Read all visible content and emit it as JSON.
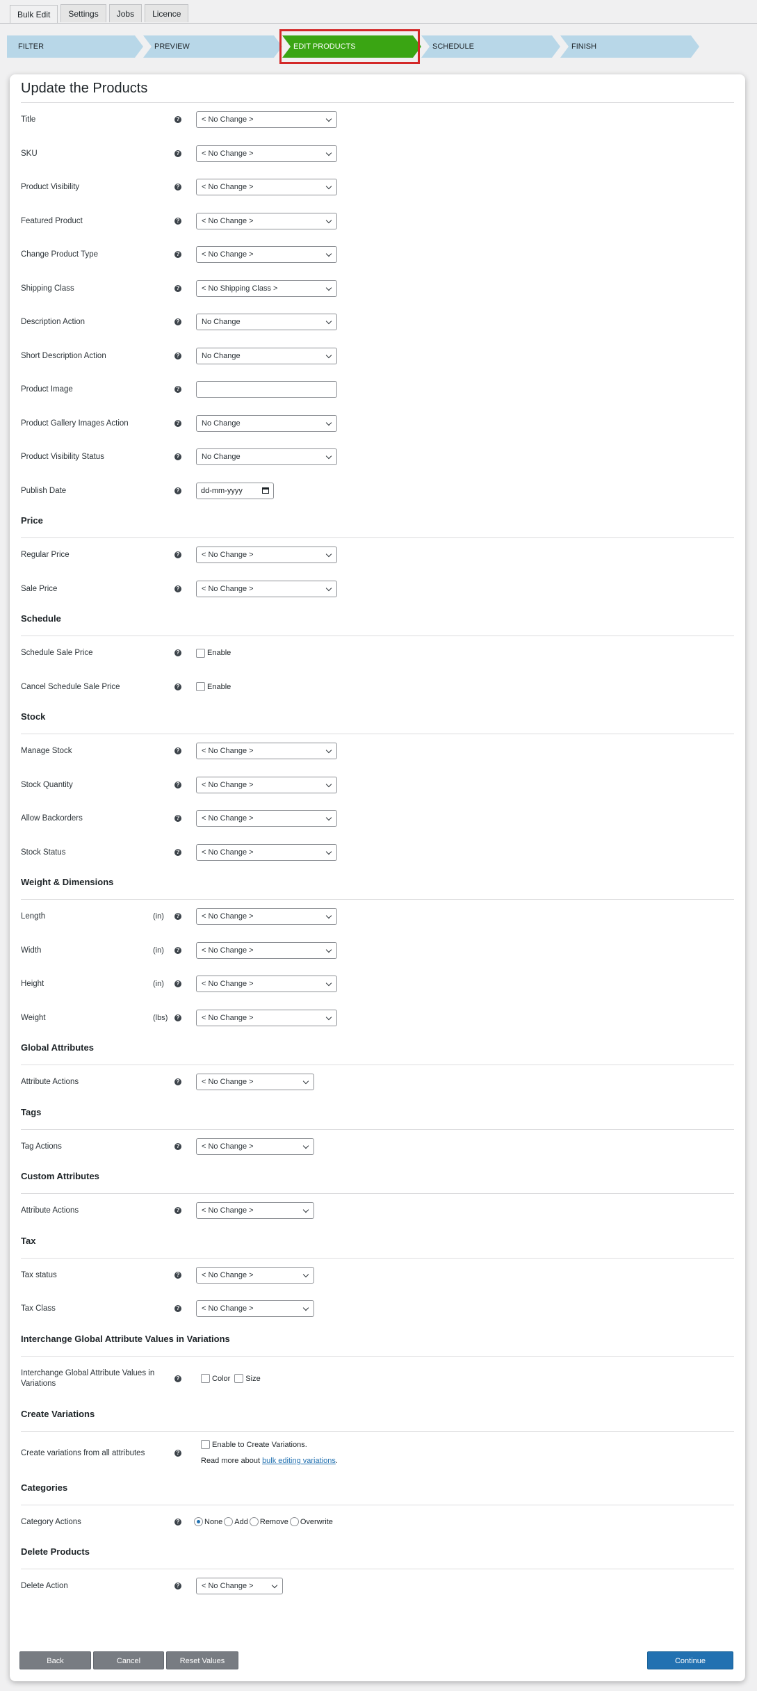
{
  "tabs": [
    "Bulk Edit",
    "Settings",
    "Jobs",
    "Licence"
  ],
  "steps": [
    "FILTER",
    "PREVIEW",
    "EDIT PRODUCTS",
    "SCHEDULE",
    "FINISH"
  ],
  "panel_title": "Update the Products",
  "help_glyph": "?",
  "general": {
    "title": {
      "label": "Title",
      "value": "< No Change >"
    },
    "sku": {
      "label": "SKU",
      "value": "< No Change >"
    },
    "visibility": {
      "label": "Product Visibility",
      "value": "< No Change >"
    },
    "featured": {
      "label": "Featured Product",
      "value": "< No Change >"
    },
    "type": {
      "label": "Change Product Type",
      "value": "< No Change >"
    },
    "shipping": {
      "label": "Shipping Class",
      "value": "< No Shipping Class >"
    },
    "description": {
      "label": "Description Action",
      "value": "No Change"
    },
    "short_description": {
      "label": "Short Description Action",
      "value": "No Change"
    },
    "image": {
      "label": "Product Image",
      "value": ""
    },
    "gallery": {
      "label": "Product Gallery Images Action",
      "value": "No Change"
    },
    "visibility_status": {
      "label": "Product Visibility Status",
      "value": "No Change"
    },
    "publish_date": {
      "label": "Publish Date",
      "placeholder": "dd-mm-yyyy"
    }
  },
  "price": {
    "heading": "Price",
    "regular": {
      "label": "Regular Price",
      "value": "< No Change >"
    },
    "sale": {
      "label": "Sale Price",
      "value": "< No Change >"
    }
  },
  "schedule": {
    "heading": "Schedule",
    "sale": {
      "label": "Schedule Sale Price",
      "option": "Enable"
    },
    "cancel": {
      "label": "Cancel Schedule Sale Price",
      "option": "Enable"
    }
  },
  "stock": {
    "heading": "Stock",
    "manage": {
      "label": "Manage Stock",
      "value": "< No Change >"
    },
    "quantity": {
      "label": "Stock Quantity",
      "value": "< No Change >"
    },
    "backorders": {
      "label": "Allow Backorders",
      "value": "< No Change >"
    },
    "status": {
      "label": "Stock Status",
      "value": "< No Change >"
    }
  },
  "dimensions": {
    "heading": "Weight & Dimensions",
    "length": {
      "label": "Length",
      "unit": "(in)",
      "value": "< No Change >"
    },
    "width": {
      "label": "Width",
      "unit": "(in)",
      "value": "< No Change >"
    },
    "height": {
      "label": "Height",
      "unit": "(in)",
      "value": "< No Change >"
    },
    "weight": {
      "label": "Weight",
      "unit": "(lbs)",
      "value": "< No Change >"
    }
  },
  "global_attributes": {
    "heading": "Global Attributes",
    "action": {
      "label": "Attribute Actions",
      "value": "< No Change >"
    }
  },
  "tags": {
    "heading": "Tags",
    "action": {
      "label": "Tag Actions",
      "value": "< No Change >"
    }
  },
  "custom_attributes": {
    "heading": "Custom Attributes",
    "action": {
      "label": "Attribute Actions",
      "value": "< No Change >"
    }
  },
  "tax": {
    "heading": "Tax",
    "status": {
      "label": "Tax status",
      "value": "< No Change >"
    },
    "class": {
      "label": "Tax Class",
      "value": "< No Change >"
    }
  },
  "interchange": {
    "heading": "Interchange Global Attribute Values in Variations",
    "label_line1": "Interchange Global Attribute Values in",
    "label_line2": "Variations",
    "options": [
      "Color",
      "Size"
    ]
  },
  "variations": {
    "heading": "Create Variations",
    "label": "Create variations from all attributes",
    "option": "Enable to Create Variations.",
    "note_prefix": "Read more about ",
    "note_link": "bulk editing variations",
    "note_suffix": "."
  },
  "categories": {
    "heading": "Categories",
    "label": "Category Actions",
    "options": [
      "None",
      "Add",
      "Remove",
      "Overwrite"
    ],
    "selected": "None"
  },
  "delete": {
    "heading": "Delete Products",
    "label": "Delete Action",
    "value": "< No Change >"
  },
  "buttons": {
    "back": "Back",
    "cancel": "Cancel",
    "reset": "Reset Values",
    "continue": "Continue"
  }
}
